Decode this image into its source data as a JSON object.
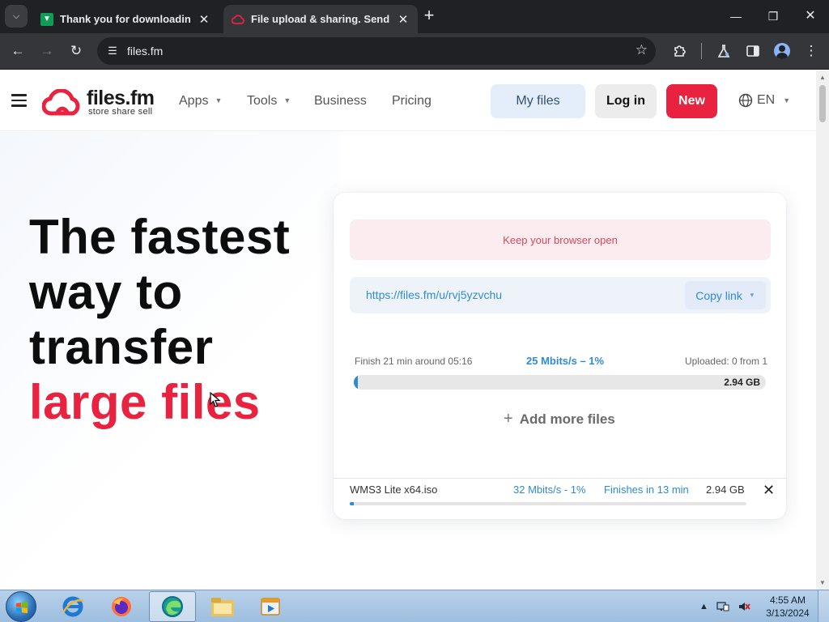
{
  "browser": {
    "tabs": [
      {
        "title": "Thank you for downloading M",
        "active": false
      },
      {
        "title": "File upload & sharing. Send la",
        "active": true
      }
    ],
    "url": "files.fm"
  },
  "site": {
    "logo_name": "files.fm",
    "logo_tagline": "store share sell",
    "nav": {
      "apps": "Apps",
      "tools": "Tools",
      "business": "Business",
      "pricing": "Pricing"
    },
    "buttons": {
      "my_files": "My files",
      "login": "Log in",
      "new": "New"
    },
    "language": "EN",
    "brand_color": "#e8223f"
  },
  "hero": {
    "line1": "The fastest",
    "line2": "way to",
    "line3": "transfer",
    "line4": "large files"
  },
  "upload": {
    "notice": "Keep your browser open",
    "share_link": "https://files.fm/u/rvj5yzvchu",
    "copy_label": "Copy link",
    "finish_text": "Finish 21 min around 05:16",
    "speed_text": "25 Mbits/s – 1%",
    "uploaded_text": "Uploaded: 0 from 1",
    "total_size": "2.94 GB",
    "progress_percent": 1,
    "add_more": "Add more files",
    "file": {
      "name": "WMS3 Lite x64.iso",
      "speed": "32 Mbits/s - 1%",
      "eta": "Finishes in 13 min",
      "size": "2.94 GB",
      "progress_percent": 1
    }
  },
  "taskbar": {
    "time": "4:55 AM",
    "date": "3/13/2024",
    "apps": [
      "internet-explorer",
      "firefox",
      "edge-browser",
      "file-explorer",
      "media-player"
    ]
  }
}
